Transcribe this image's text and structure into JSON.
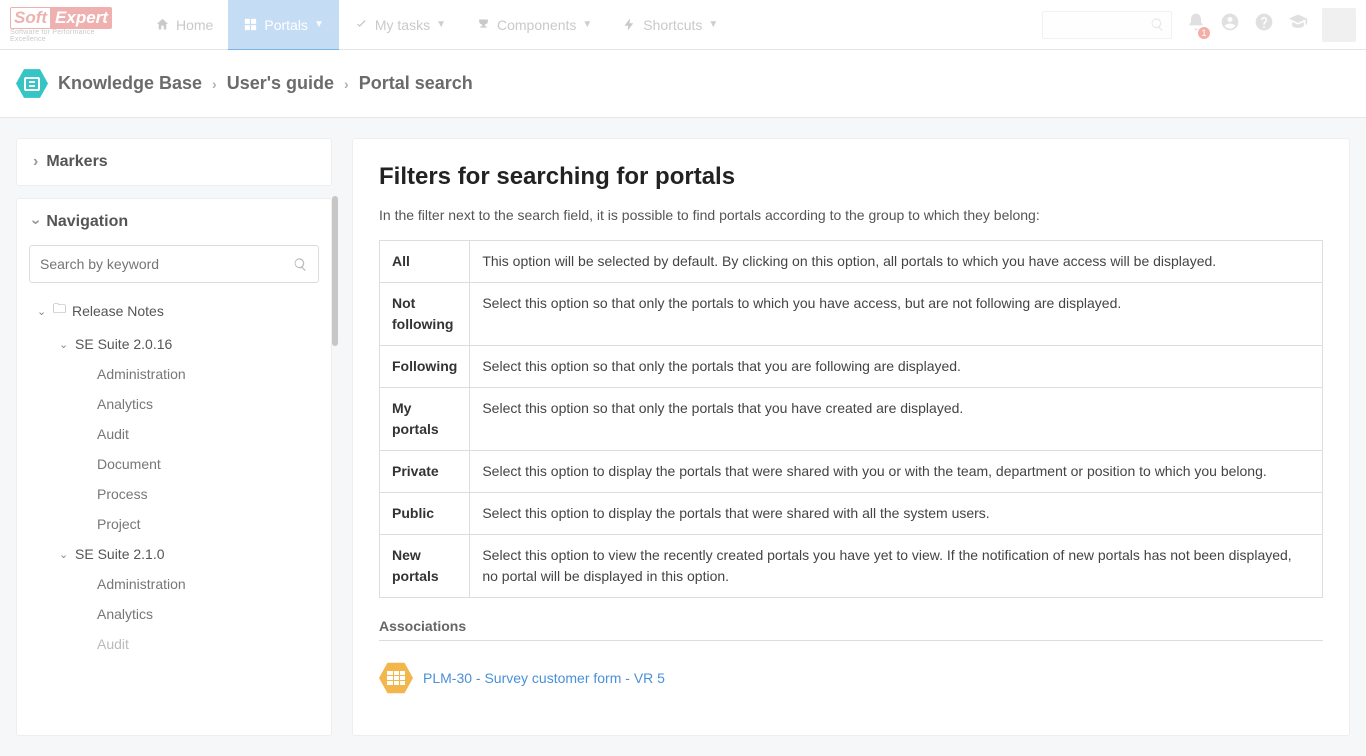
{
  "topnav": {
    "logo_soft": "Soft",
    "logo_expert": "Expert",
    "logo_tag": "Software for Performance Excellence",
    "home": "Home",
    "portals": "Portals",
    "mytasks": "My tasks",
    "components": "Components",
    "shortcuts": "Shortcuts",
    "notif_badge": "1"
  },
  "breadcrumb": {
    "kb": "Knowledge Base",
    "ug": "User's guide",
    "ps": "Portal search"
  },
  "sidebar": {
    "markers": "Markers",
    "navigation": "Navigation",
    "search_placeholder": "Search by keyword",
    "tree": {
      "release_notes": "Release Notes",
      "suite_2016": "SE Suite 2.0.16",
      "admin1": "Administration",
      "analytics1": "Analytics",
      "audit1": "Audit",
      "document1": "Document",
      "process1": "Process",
      "project1": "Project",
      "suite_210": "SE Suite 2.1.0",
      "admin2": "Administration",
      "analytics2": "Analytics",
      "audit2": "Audit"
    }
  },
  "main": {
    "title": "Filters for searching for portals",
    "intro": "In the filter next to the search field, it is possible to find portals according to the group to which they belong:",
    "rows": [
      {
        "name": "All",
        "desc": "This option will be selected by default. By clicking on this option, all portals to which you have access will be displayed."
      },
      {
        "name": "Not following",
        "desc": "Select this option so that only the portals to which you have access, but are not following are displayed."
      },
      {
        "name": "Following",
        "desc": "Select this option so that only the portals that you are following are displayed."
      },
      {
        "name": "My portals",
        "desc": "Select this option so that only the portals that you have created are displayed."
      },
      {
        "name": "Private",
        "desc": "Select this option to display the portals that were shared with you or with the team, department or position to which you belong."
      },
      {
        "name": "Public",
        "desc": "Select this option to display the portals that were shared with all the system users."
      },
      {
        "name": "New portals",
        "desc": "Select this option to view the recently created portals you have yet to view. If the notification of new portals has not been displayed, no portal will be displayed in this option."
      }
    ],
    "associations_head": "Associations",
    "assoc_link": "PLM-30 - Survey customer form - VR 5"
  }
}
